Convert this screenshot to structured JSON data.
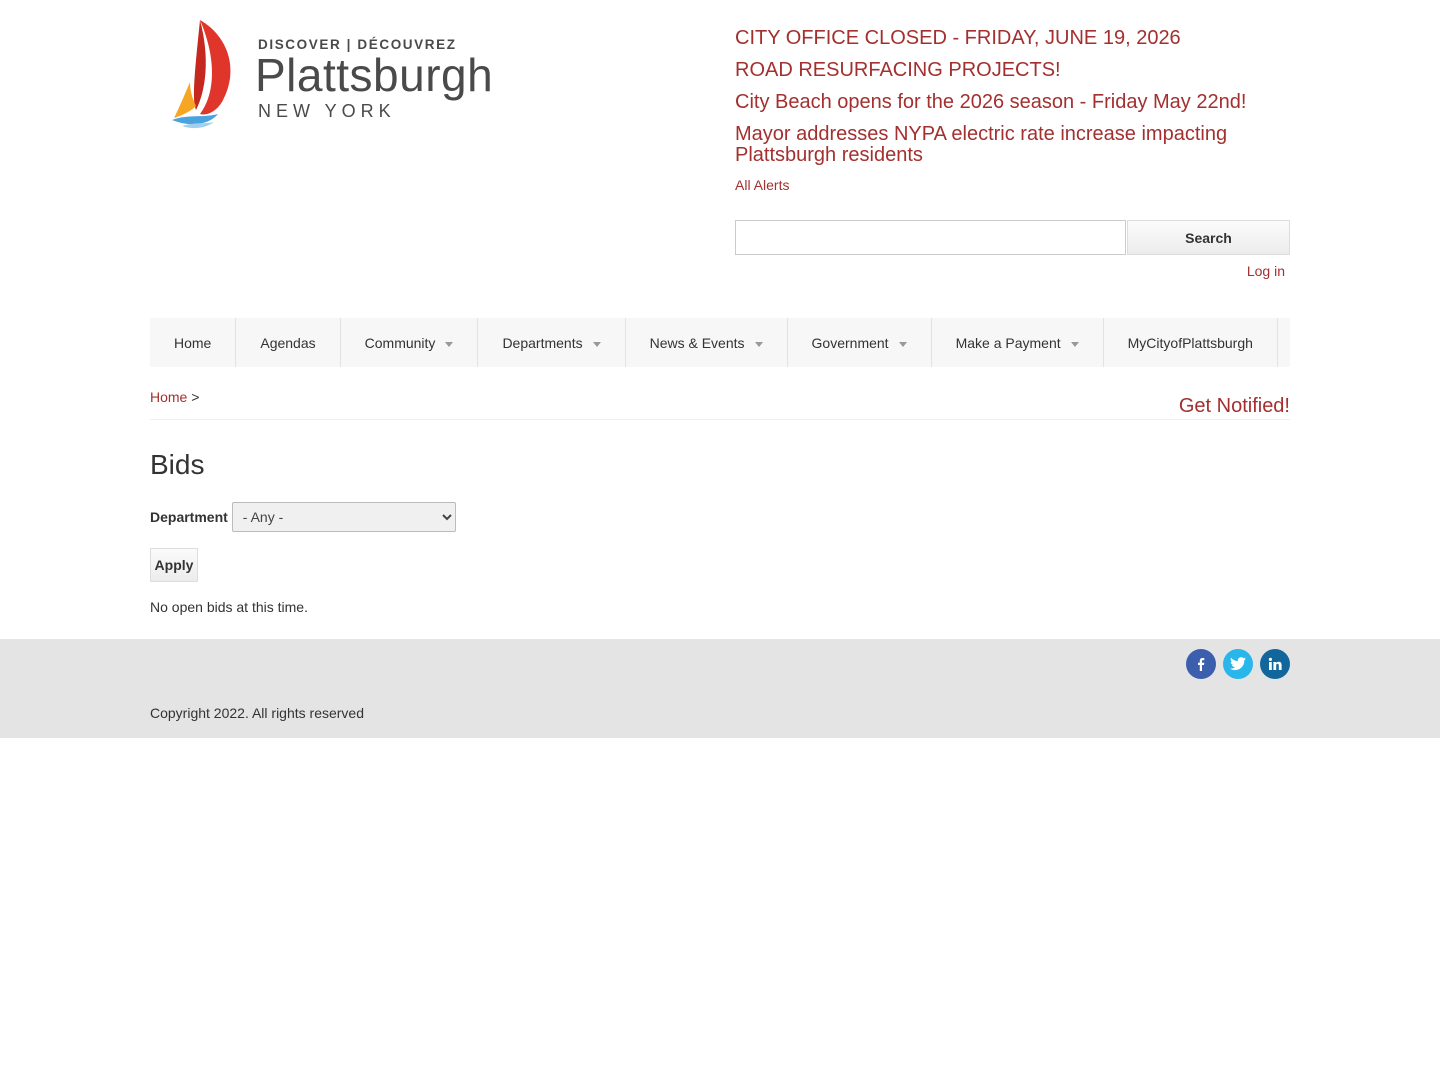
{
  "brand": {
    "discover_line": "DISCOVER | DÉCOUVREZ",
    "name": "Plattsburgh",
    "region": "NEW YORK"
  },
  "alerts": {
    "items": [
      "CITY OFFICE CLOSED - FRIDAY, JUNE 19, 2026",
      "ROAD RESURFACING PROJECTS!",
      "City Beach opens for the 2026 season - Friday May 22nd!",
      "Mayor addresses NYPA electric rate increase impacting Plattsburgh residents"
    ],
    "all_alerts_label": "All Alerts"
  },
  "search": {
    "value": "",
    "button_label": "Search"
  },
  "login_label": "Log in",
  "nav": {
    "items": [
      {
        "label": "Home"
      },
      {
        "label": "Agendas"
      },
      {
        "label": "Community"
      },
      {
        "label": "Departments"
      },
      {
        "label": "News & Events"
      },
      {
        "label": "Government"
      },
      {
        "label": "Make a Payment"
      },
      {
        "label": "MyCityofPlattsburgh"
      }
    ]
  },
  "breadcrumb": {
    "home_label": "Home",
    "separator": ">"
  },
  "get_notified_label": "Get Notified!",
  "page": {
    "title": "Bids",
    "filter_label": "Department",
    "department_selected": "- Any -",
    "apply_label": "Apply",
    "empty_message": "No open bids at this time."
  },
  "footer": {
    "copyright": "Copyright 2022. All rights reserved",
    "social": [
      "facebook-icon",
      "twitter-icon",
      "linkedin-icon"
    ]
  },
  "colors": {
    "accent": "#a3302f",
    "footer_bg": "#e4e4e4",
    "nav_bg": "#f7f7f7",
    "facebook": "#3b5fad",
    "twitter": "#29b6ea",
    "linkedin": "#11669c"
  }
}
